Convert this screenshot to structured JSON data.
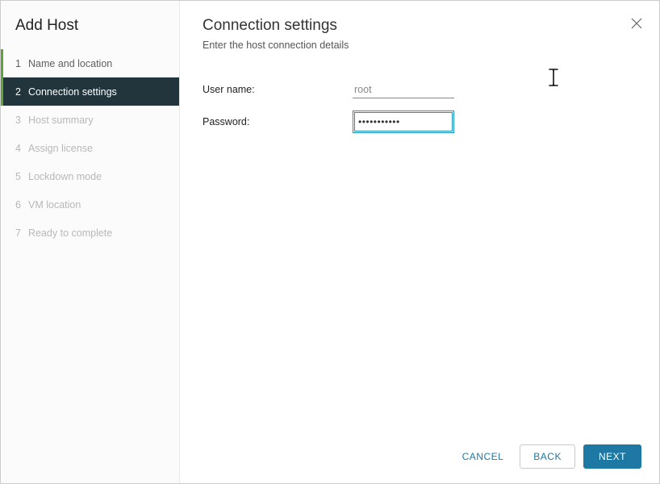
{
  "wizard_title": "Add Host",
  "steps": [
    {
      "num": "1",
      "label": "Name and location",
      "state": "completed"
    },
    {
      "num": "2",
      "label": "Connection settings",
      "state": "active"
    },
    {
      "num": "3",
      "label": "Host summary",
      "state": "disabled"
    },
    {
      "num": "4",
      "label": "Assign license",
      "state": "disabled"
    },
    {
      "num": "5",
      "label": "Lockdown mode",
      "state": "disabled"
    },
    {
      "num": "6",
      "label": "VM location",
      "state": "disabled"
    },
    {
      "num": "7",
      "label": "Ready to complete",
      "state": "disabled"
    }
  ],
  "page": {
    "title": "Connection settings",
    "subtitle": "Enter the host connection details"
  },
  "form": {
    "username_label": "User name:",
    "username_value": "root",
    "password_label": "Password:",
    "password_value": "•••••••••••"
  },
  "buttons": {
    "cancel": "CANCEL",
    "back": "BACK",
    "next": "NEXT"
  }
}
